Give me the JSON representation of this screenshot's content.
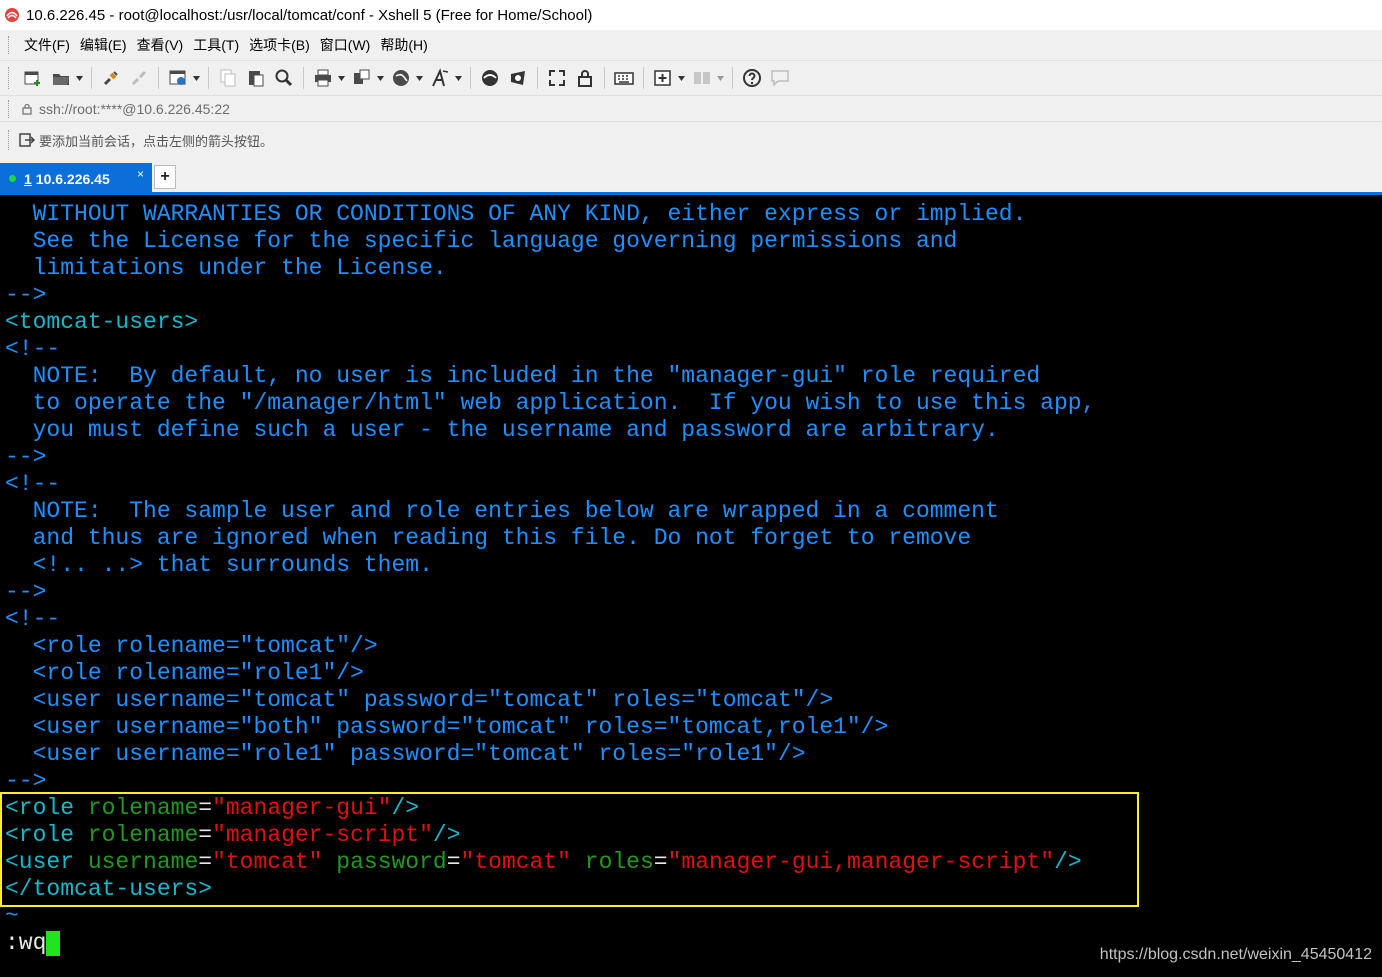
{
  "window": {
    "title": "10.6.226.45  - root@localhost:/usr/local/tomcat/conf - Xshell 5 (Free for Home/School)"
  },
  "menu": [
    {
      "label": "文件(F)"
    },
    {
      "label": "编辑(E)"
    },
    {
      "label": "查看(V)"
    },
    {
      "label": "工具(T)"
    },
    {
      "label": "选项卡(B)"
    },
    {
      "label": "窗口(W)"
    },
    {
      "label": "帮助(H)"
    }
  ],
  "address": "ssh://root:****@10.6.226.45:22",
  "hint": "要添加当前会话，点击左侧的箭头按钮。",
  "tabs": [
    {
      "number": "1",
      "label": "10.6.226.45",
      "close": "×"
    }
  ],
  "tab_add": "+",
  "colors": {
    "comment": "#1e90ff",
    "tag": "#18b7c9",
    "attr": "#1f9a1f",
    "string": "#e01010",
    "highlight_box": "#ffef29",
    "cursor": "#1ee51e"
  },
  "terminal": {
    "lines": [
      "  WITHOUT WARRANTIES OR CONDITIONS OF ANY KIND, either express or implied.",
      "  See the License for the specific language governing permissions and",
      "  limitations under the License.",
      "-->",
      "<tomcat-users>",
      "<!--",
      "  NOTE:  By default, no user is included in the \"manager-gui\" role required",
      "  to operate the \"/manager/html\" web application.  If you wish to use this app,",
      "  you must define such a user - the username and password are arbitrary.",
      "-->",
      "<!--",
      "  NOTE:  The sample user and role entries below are wrapped in a comment",
      "  and thus are ignored when reading this file. Do not forget to remove",
      "  <!.. ..> that surrounds them.",
      "-->",
      "<!--",
      "  <role rolename=\"tomcat\"/>",
      "  <role rolename=\"role1\"/>",
      "  <user username=\"tomcat\" password=\"tomcat\" roles=\"tomcat\"/>",
      "  <user username=\"both\" password=\"tomcat\" roles=\"tomcat,role1\"/>",
      "  <user username=\"role1\" password=\"tomcat\" roles=\"role1\"/>",
      "-->"
    ],
    "highlighted": [
      {
        "tag_open": "<role ",
        "attr1": "rolename",
        "eq1": "=",
        "val1": "\"manager-gui\"",
        "tag_close": "/>"
      },
      {
        "tag_open": "<role ",
        "attr1": "rolename",
        "eq1": "=",
        "val1": "\"manager-script\"",
        "tag_close": "/>"
      },
      {
        "tag_open": "<user ",
        "attr1": "username",
        "eq1": "=",
        "val1": "\"tomcat\"",
        "sp1": " ",
        "attr2": "password",
        "eq2": "=",
        "val2": "\"tomcat\"",
        "sp2": " ",
        "attr3": "roles",
        "eq3": "=",
        "val3": "\"manager-gui,manager-script\"",
        "tag_close": "/>"
      },
      {
        "text": "</tomcat-users>"
      }
    ],
    "tilde": "~",
    "command": ":wq"
  },
  "watermark": "https://blog.csdn.net/weixin_45450412"
}
